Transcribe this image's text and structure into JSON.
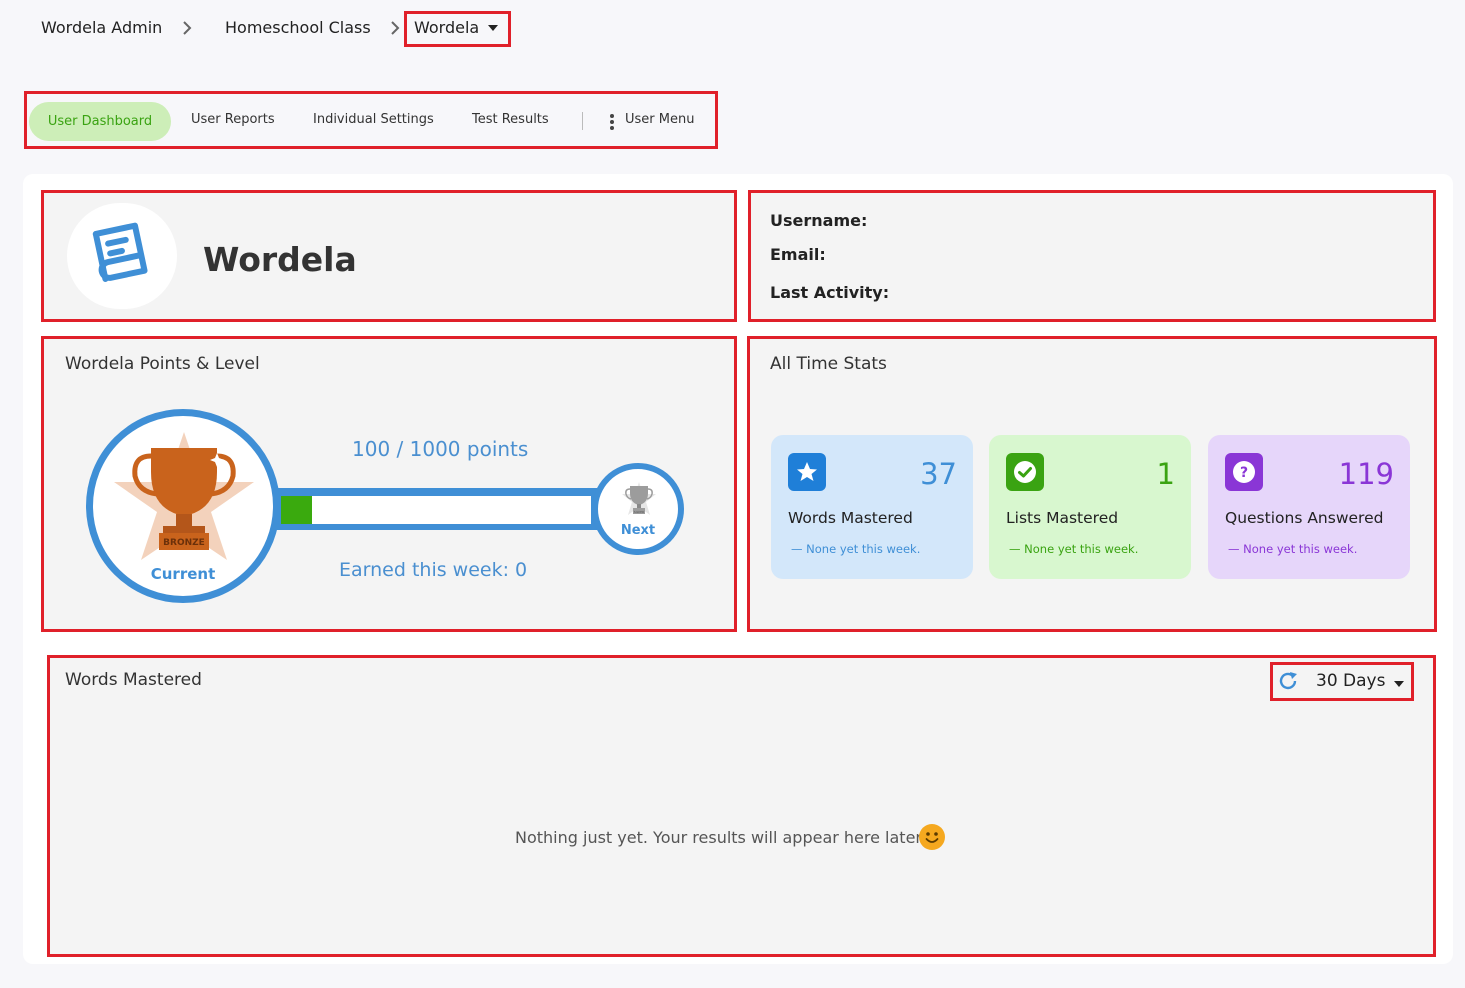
{
  "breadcrumb": {
    "items": [
      "Wordela Admin",
      "Homeschool Class"
    ],
    "current": "Wordela"
  },
  "tabs": [
    {
      "label": "User Dashboard",
      "active": true
    },
    {
      "label": "User Reports"
    },
    {
      "label": "Individual Settings"
    },
    {
      "label": "Test Results"
    },
    {
      "label": "User Menu"
    }
  ],
  "profile": {
    "name": "Wordela",
    "avatar_icon": "book-icon"
  },
  "account": {
    "username_label": "Username:",
    "email_label": "Email:",
    "last_activity_label": "Last Activity:"
  },
  "points": {
    "title": "Wordela Points & Level",
    "progress_text": "100 / 1000 points",
    "current": 100,
    "target": 1000,
    "earned_week": "Earned this week: 0",
    "current_label": "Current",
    "next_label": "Next",
    "current_badge": "BRONZE",
    "next_badge": "SILVER"
  },
  "stats": {
    "title": "All Time Stats",
    "cards": [
      {
        "value": "37",
        "label": "Words Mastered",
        "sub": "None yet this week.",
        "icon": "star-icon"
      },
      {
        "value": "1",
        "label": "Lists Mastered",
        "sub": "None yet this week.",
        "icon": "check-icon"
      },
      {
        "value": "119",
        "label": "Questions Answered",
        "sub": "None yet this week.",
        "icon": "question-icon"
      }
    ]
  },
  "words_mastered": {
    "title": "Words Mastered",
    "range": "30 Days",
    "empty": "Nothing just yet. Your results will appear here later"
  },
  "colors": {
    "accent_blue": "#3f8fd6",
    "accent_green": "#3aa312",
    "accent_purple": "#8a36d6",
    "highlight_red": "#e0202a",
    "bronze": "#c9631c"
  }
}
